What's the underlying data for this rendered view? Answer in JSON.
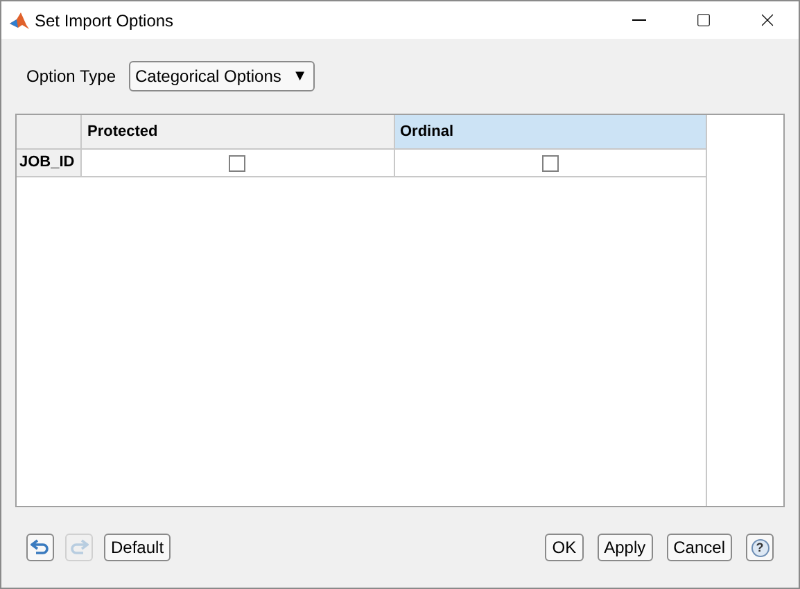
{
  "window": {
    "title": "Set Import Options"
  },
  "option_type": {
    "label": "Option Type",
    "value": "Categorical Options",
    "arrow": "▼"
  },
  "table": {
    "columns": [
      {
        "label": "Protected",
        "selected": false
      },
      {
        "label": "Ordinal",
        "selected": true
      }
    ],
    "rows": [
      {
        "label": "JOB_ID",
        "cells": [
          {
            "checked": false
          },
          {
            "checked": false
          }
        ]
      }
    ]
  },
  "toolbar": {
    "undo": {
      "disabled": false
    },
    "redo": {
      "disabled": true
    },
    "default_label": "Default"
  },
  "buttons": [
    {
      "kind": "text",
      "label": "OK"
    },
    {
      "kind": "text",
      "label": "Apply"
    },
    {
      "kind": "text",
      "label": "Cancel"
    },
    {
      "kind": "help",
      "label": "?"
    }
  ]
}
